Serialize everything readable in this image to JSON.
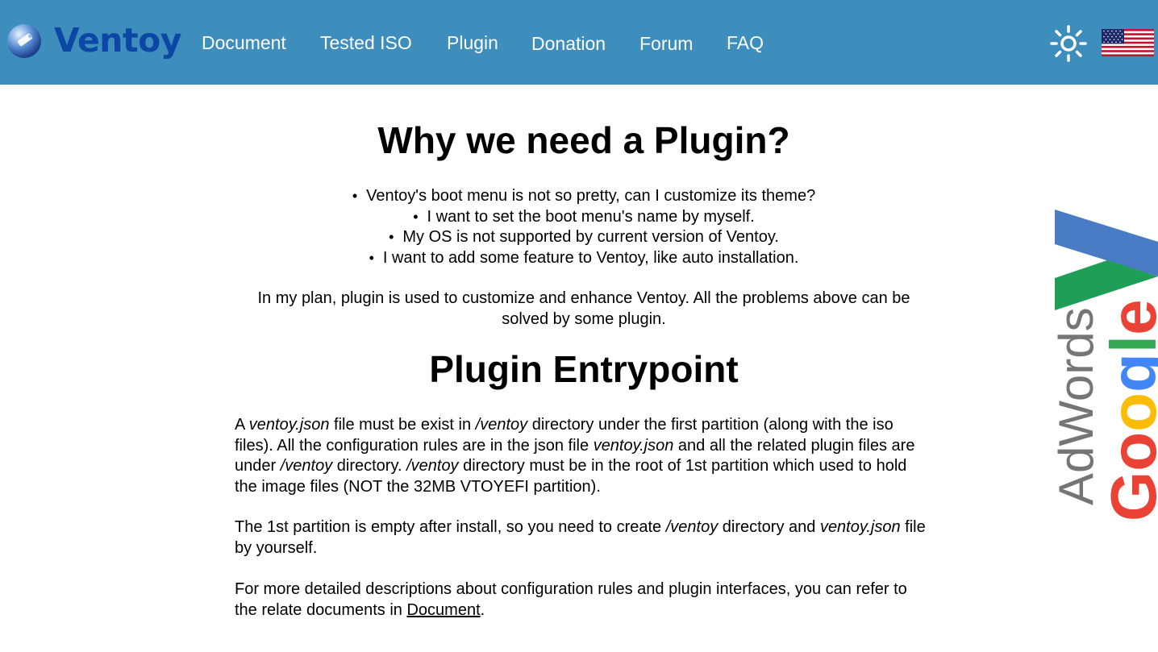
{
  "navbar": {
    "brand": "Ventoy",
    "links": [
      "Document",
      "Tested ISO",
      "Plugin",
      "Donation",
      "Forum",
      "FAQ"
    ],
    "theme_icon": "sun-icon",
    "language_icon": "us-flag-icon",
    "background": "#3d8dbd",
    "brand_color": "#0d47a6"
  },
  "main": {
    "heading1": "Why we need a Plugin?",
    "bullets": [
      "Ventoy's boot menu is not so pretty, can I customize its theme?",
      "I want to set the boot menu's name by myself.",
      "My OS is not supported by current version of Ventoy.",
      "I want to add some feature to Ventoy, like auto installation."
    ],
    "plan": "In my plan, plugin is used to customize and enhance Ventoy. All the problems above can be solved by some plugin.",
    "heading2": "Plugin Entrypoint",
    "p1": {
      "t1": "A ",
      "e1": "ventoy.json",
      "t2": " file must be exist in ",
      "e2": "/ventoy",
      "t3": " directory under the first partition (along with the iso files). All the configuration rules are in the json file ",
      "e3": "ventoy.json",
      "t4": " and all the related plugin files are under ",
      "e4": "/ventoy",
      "t5": " directory. ",
      "e5": "/ventoy",
      "t6": " directory must be in the root of 1st partition which used to hold the image files (NOT the 32MB VTOYEFI partition)."
    },
    "p2": {
      "t1": "The 1st partition is empty after install, so you need to create ",
      "e1": "/ventoy",
      "t2": " directory and ",
      "e2": "ventoy.json",
      "t3": " file by yourself."
    },
    "p3": {
      "t1": "For more detailed descriptions about configuration rules and plugin interfaces, you can refer to the relate documents in ",
      "link": "Document",
      "t2": "."
    }
  },
  "ad": {
    "brand": "Google",
    "product": "AdWords",
    "colors": {
      "blue": "#4285f4",
      "red": "#ea4335",
      "yellow": "#fbbc05",
      "green": "#34a853",
      "gray": "#757575"
    }
  }
}
